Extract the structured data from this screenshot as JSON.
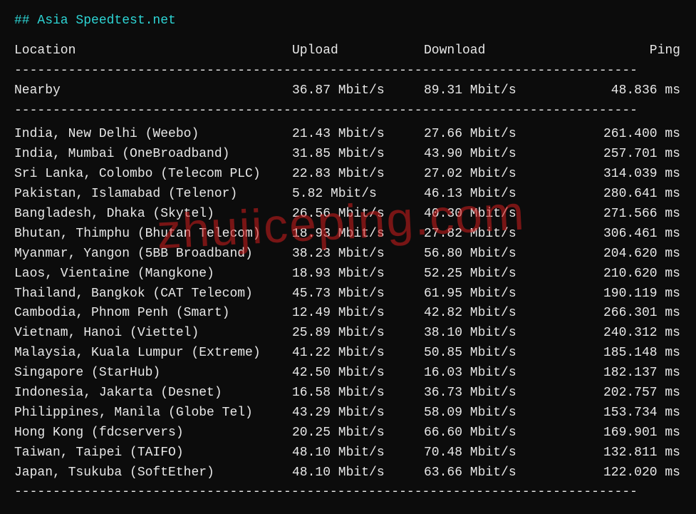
{
  "title": "## Asia Speedtest.net",
  "separator": "---------------------------------------------------------------------------------",
  "headers": {
    "location": "Location",
    "upload": "Upload",
    "download": "Download",
    "ping": "Ping"
  },
  "nearby": {
    "location": "Nearby",
    "upload": "36.87 Mbit/s",
    "download": "89.31 Mbit/s",
    "ping": "48.836 ms"
  },
  "rows": [
    {
      "location": "India, New Delhi (Weebo)",
      "upload": "21.43 Mbit/s",
      "download": "27.66 Mbit/s",
      "ping": "261.400 ms"
    },
    {
      "location": "India, Mumbai (OneBroadband)",
      "upload": "31.85 Mbit/s",
      "download": "43.90 Mbit/s",
      "ping": "257.701 ms"
    },
    {
      "location": "Sri Lanka, Colombo (Telecom PLC)",
      "upload": "22.83 Mbit/s",
      "download": "27.02 Mbit/s",
      "ping": "314.039 ms"
    },
    {
      "location": "Pakistan, Islamabad (Telenor)",
      "upload": "5.82 Mbit/s",
      "download": "46.13 Mbit/s",
      "ping": "280.641 ms"
    },
    {
      "location": "Bangladesh, Dhaka (Skytel)",
      "upload": "26.56 Mbit/s",
      "download": "40.30 Mbit/s",
      "ping": "271.566 ms"
    },
    {
      "location": "Bhutan, Thimphu (Bhutan Telecom)",
      "upload": "18.93 Mbit/s",
      "download": "27.82 Mbit/s",
      "ping": "306.461 ms"
    },
    {
      "location": "Myanmar, Yangon (5BB Broadband)",
      "upload": "38.23 Mbit/s",
      "download": "56.80 Mbit/s",
      "ping": "204.620 ms"
    },
    {
      "location": "Laos, Vientaine (Mangkone)",
      "upload": "18.93 Mbit/s",
      "download": "52.25 Mbit/s",
      "ping": "210.620 ms"
    },
    {
      "location": "Thailand, Bangkok (CAT Telecom)",
      "upload": "45.73 Mbit/s",
      "download": "61.95 Mbit/s",
      "ping": "190.119 ms"
    },
    {
      "location": "Cambodia, Phnom Penh (Smart)",
      "upload": "12.49 Mbit/s",
      "download": "42.82 Mbit/s",
      "ping": "266.301 ms"
    },
    {
      "location": "Vietnam, Hanoi (Viettel)",
      "upload": "25.89 Mbit/s",
      "download": "38.10 Mbit/s",
      "ping": "240.312 ms"
    },
    {
      "location": "Malaysia, Kuala Lumpur (Extreme)",
      "upload": "41.22 Mbit/s",
      "download": "50.85 Mbit/s",
      "ping": "185.148 ms"
    },
    {
      "location": "Singapore (StarHub)",
      "upload": "42.50 Mbit/s",
      "download": "16.03 Mbit/s",
      "ping": "182.137 ms"
    },
    {
      "location": "Indonesia, Jakarta (Desnet)",
      "upload": "16.58 Mbit/s",
      "download": "36.73 Mbit/s",
      "ping": "202.757 ms"
    },
    {
      "location": "Philippines, Manila (Globe Tel)",
      "upload": "43.29 Mbit/s",
      "download": "58.09 Mbit/s",
      "ping": "153.734 ms"
    },
    {
      "location": "Hong Kong (fdcservers)",
      "upload": "20.25 Mbit/s",
      "download": "66.60 Mbit/s",
      "ping": "169.901 ms"
    },
    {
      "location": "Taiwan, Taipei (TAIFO)",
      "upload": "48.10 Mbit/s",
      "download": "70.48 Mbit/s",
      "ping": "132.811 ms"
    },
    {
      "location": "Japan, Tsukuba (SoftEther)",
      "upload": "48.10 Mbit/s",
      "download": "63.66 Mbit/s",
      "ping": "122.020 ms"
    }
  ],
  "watermark": "zhujiceping.com"
}
